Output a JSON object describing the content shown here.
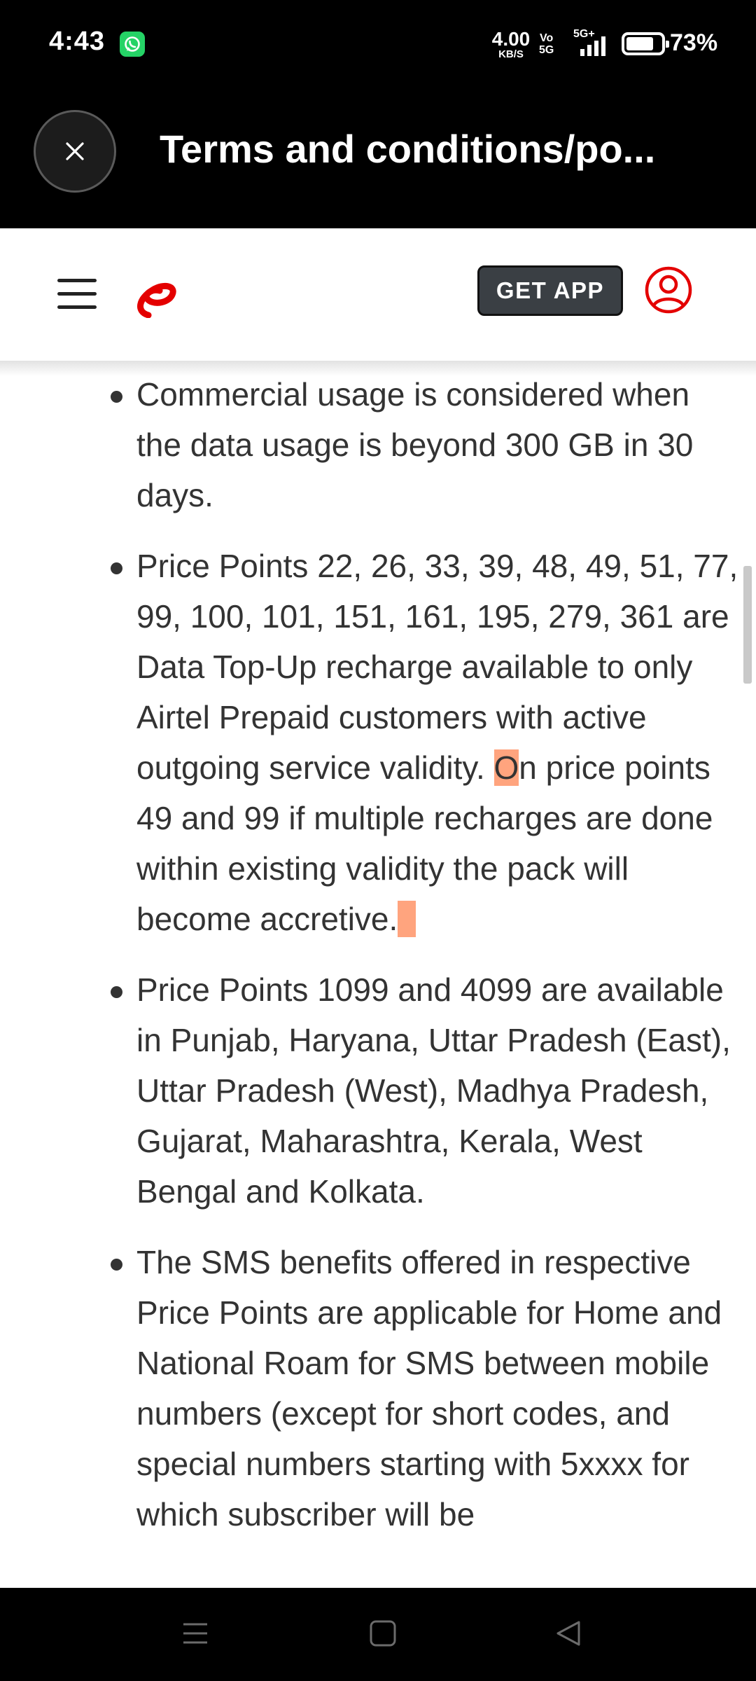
{
  "status_bar": {
    "time": "4:43",
    "app_icon": "whatsapp-icon",
    "net_speed_value": "4.00",
    "net_speed_unit": "KB/S",
    "volte_label": "Vo\n5G",
    "network_label": "5G+",
    "battery_percent": "73%",
    "battery_level": 0.73
  },
  "title_bar": {
    "close_icon": "close-icon",
    "title": "Terms and conditions/po..."
  },
  "site_header": {
    "menu_icon": "hamburger-menu-icon",
    "logo_icon": "airtel-logo-icon",
    "get_app_label": "GET APP",
    "profile_icon": "user-profile-icon",
    "brand_color": "#e40000"
  },
  "content": {
    "bullets": [
      {
        "text": "Commercial usage is considered when the data usage is beyond 300 GB in 30 days."
      },
      {
        "segments": [
          "Price Points 22, 26, 33, 39, 48, 49, 51, 77, 99, 100, 101, 151, 161, 195, 279, 361 are Data Top-Up recharge available to only Airtel Prepaid customers with active outgoing service validity. ",
          "O",
          "n price points 49 and 99 if multiple recharges are done within existing validity the pack will become accretive."
        ]
      },
      {
        "text": "Price Points 1099 and 4099 are available in Punjab, Haryana, Uttar Pradesh (East), Uttar Pradesh (West), Madhya Pradesh, Gujarat, Maharashtra, Kerala, West Bengal and Kolkata."
      },
      {
        "text": "The SMS benefits offered in respective Price Points are applicable for Home and National Roam for SMS between mobile numbers (except for short codes, and special numbers starting with 5xxxx for which subscriber will be"
      }
    ],
    "highlight_color": "#ffa47e"
  },
  "nav_bar": {
    "menu_icon": "recents-menu-icon",
    "home_icon": "home-square-icon",
    "back_icon": "back-triangle-icon"
  }
}
